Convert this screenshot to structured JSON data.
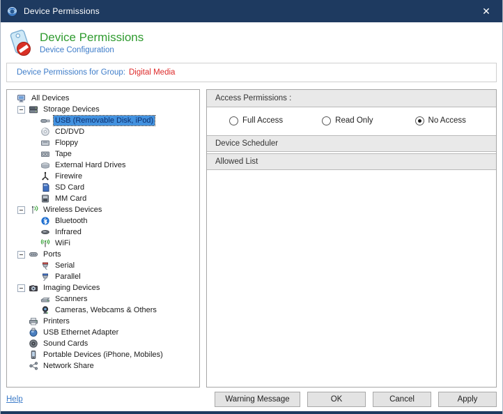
{
  "window": {
    "title": "Device Permissions",
    "close_glyph": "✕"
  },
  "header": {
    "title": "Device Permissions",
    "subtitle": "Device Configuration"
  },
  "banner": {
    "label": "Device Permissions for Group:",
    "value": "Digital Media"
  },
  "tree": {
    "items": [
      {
        "label": "All Devices",
        "level": 0,
        "icon": "computer-icon",
        "expander": false,
        "selected": false
      },
      {
        "label": "Storage Devices",
        "level": 1,
        "icon": "drives-icon",
        "expander": true,
        "selected": false
      },
      {
        "label": "USB (Removable Disk, iPod)",
        "level": 2,
        "icon": "usb-stick-icon",
        "expander": false,
        "selected": true
      },
      {
        "label": "CD/DVD",
        "level": 2,
        "icon": "cd-icon",
        "expander": false,
        "selected": false
      },
      {
        "label": "Floppy",
        "level": 2,
        "icon": "floppy-icon",
        "expander": false,
        "selected": false
      },
      {
        "label": "Tape",
        "level": 2,
        "icon": "tape-icon",
        "expander": false,
        "selected": false
      },
      {
        "label": "External Hard Drives",
        "level": 2,
        "icon": "ext-hdd-icon",
        "expander": false,
        "selected": false
      },
      {
        "label": "Firewire",
        "level": 2,
        "icon": "firewire-icon",
        "expander": false,
        "selected": false
      },
      {
        "label": "SD Card",
        "level": 2,
        "icon": "sd-card-icon",
        "expander": false,
        "selected": false
      },
      {
        "label": "MM Card",
        "level": 2,
        "icon": "mm-card-icon",
        "expander": false,
        "selected": false
      },
      {
        "label": "Wireless Devices",
        "level": 1,
        "icon": "antenna-icon",
        "expander": true,
        "selected": false
      },
      {
        "label": "Bluetooth",
        "level": 2,
        "icon": "bluetooth-icon",
        "expander": false,
        "selected": false
      },
      {
        "label": "Infrared",
        "level": 2,
        "icon": "infrared-icon",
        "expander": false,
        "selected": false
      },
      {
        "label": "WiFi",
        "level": 2,
        "icon": "wifi-icon",
        "expander": false,
        "selected": false
      },
      {
        "label": "Ports",
        "level": 1,
        "icon": "port-icon",
        "expander": true,
        "selected": false
      },
      {
        "label": "Serial",
        "level": 2,
        "icon": "serial-port-icon",
        "expander": false,
        "selected": false
      },
      {
        "label": "Parallel",
        "level": 2,
        "icon": "parallel-port-icon",
        "expander": false,
        "selected": false
      },
      {
        "label": "Imaging Devices",
        "level": 1,
        "icon": "camera-icon",
        "expander": true,
        "selected": false
      },
      {
        "label": "Scanners",
        "level": 2,
        "icon": "scanner-icon",
        "expander": false,
        "selected": false
      },
      {
        "label": "Cameras, Webcams & Others",
        "level": 2,
        "icon": "webcam-icon",
        "expander": false,
        "selected": false
      },
      {
        "label": "Printers",
        "level": 1,
        "icon": "printer-icon",
        "expander": false,
        "selected": false
      },
      {
        "label": "USB Ethernet Adapter",
        "level": 1,
        "icon": "ethernet-adapter-icon",
        "expander": false,
        "selected": false
      },
      {
        "label": "Sound Cards",
        "level": 1,
        "icon": "sound-card-icon",
        "expander": false,
        "selected": false
      },
      {
        "label": "Portable Devices (iPhone, Mobiles)",
        "level": 1,
        "icon": "mobile-phone-icon",
        "expander": false,
        "selected": false
      },
      {
        "label": "Network Share",
        "level": 1,
        "icon": "network-share-icon",
        "expander": false,
        "selected": false
      }
    ]
  },
  "panel": {
    "access_header": "Access Permissions :",
    "radios": [
      {
        "label": "Full Access",
        "checked": false
      },
      {
        "label": "Read Only",
        "checked": false
      },
      {
        "label": "No Access",
        "checked": true
      }
    ],
    "sections": [
      "Device Scheduler",
      "Allowed List"
    ]
  },
  "footer": {
    "help": "Help",
    "buttons": [
      "Warning Message",
      "OK",
      "Cancel",
      "Apply"
    ]
  },
  "colors": {
    "titlebar": "#1e3a60",
    "green": "#2f9b2f",
    "blue": "#3d7cc9",
    "red": "#dd2a2a",
    "sel": "#4392df"
  }
}
